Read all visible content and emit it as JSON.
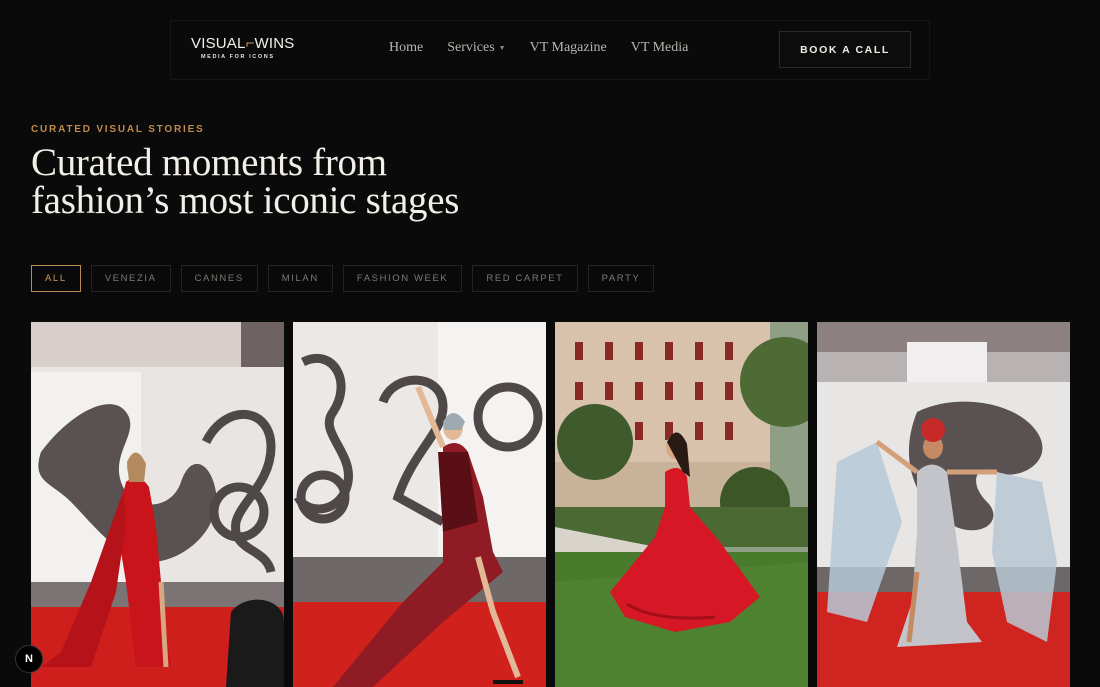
{
  "brand": {
    "logo_left": "VISUAL",
    "logo_right": "WINS",
    "tagline": "MEDIA FOR ICONS"
  },
  "nav": {
    "links": [
      {
        "label": "Home"
      },
      {
        "label": "Services",
        "has_dropdown": true,
        "icon": "chevron-down-icon"
      },
      {
        "label": "VT Magazine"
      },
      {
        "label": "VT Media"
      }
    ],
    "cta": "BOOK A CALL"
  },
  "hero": {
    "eyebrow": "CURATED VISUAL STORIES",
    "title_line1": "Curated moments from",
    "title_line2": "fashion’s most iconic stages"
  },
  "filters": {
    "items": [
      "ALL",
      "VENEZIA",
      "CANNES",
      "MILAN",
      "FASHION WEEK",
      "RED CARPET",
      "PARTY"
    ],
    "active": "ALL"
  },
  "gallery": {
    "items": [
      {
        "subject": "woman in red gown blowing a kiss on red carpet",
        "backdrop": "82 logo wall"
      },
      {
        "subject": "woman in feathered red dress waving on red carpet",
        "backdrop": "82 logo wall"
      },
      {
        "subject": "woman twirling a red gown on a lawn before a Venetian palazzo",
        "backdrop": "palazzo garden"
      },
      {
        "subject": "woman in embellished cape gown with outstretched arms",
        "backdrop": "logo wall"
      }
    ]
  },
  "dev_badge": "N",
  "colors": {
    "background": "#0a0a0a",
    "accent": "#c08a4e",
    "text": "#f2efe8",
    "muted": "#7d7973",
    "carpet_red": "#d4231e"
  }
}
